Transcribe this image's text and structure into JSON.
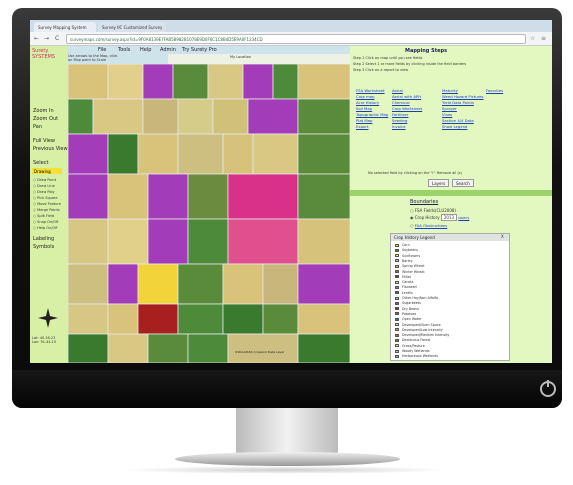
{
  "browser": {
    "tabs": [
      {
        "label": "Survey Mapping System"
      },
      {
        "label": "Survey IIC Customized Survey"
      }
    ],
    "url": "surveymaps.com/survey.aspx?id=9F0A8139E7FAB58982B1078E9D0F6C1C8B4D5E9A0F1234CD",
    "nav": {
      "back": "←",
      "forward": "→",
      "reload": "C"
    }
  },
  "leftpanel": {
    "logo": "Surety\nSYSTEMS",
    "items": [
      {
        "label": "Zoom In"
      },
      {
        "label": "Zoom Out"
      },
      {
        "label": "Pan"
      },
      {
        "label": "Full View"
      },
      {
        "label": "Previous View"
      },
      {
        "label": "Select"
      },
      {
        "label": "Drawing"
      }
    ],
    "draw_options": [
      "Draw Point",
      "Draw Line",
      "Draw Poly",
      "Pick Square",
      "Move Feature",
      "Merge Points",
      "Split Field",
      "Snap On/Off",
      "Help On/Off"
    ],
    "bottom_items": [
      {
        "label": "Labeling"
      },
      {
        "label": "Symbols"
      }
    ],
    "coords": "Lat: 40.16.23\nLon: 91.44.15"
  },
  "menubar": {
    "items": [
      "File",
      "Tools",
      "Help",
      "Admin",
      "Try Surety Pro"
    ]
  },
  "map_header": {
    "instructions": "Use arrows to the Map, click\non Map point to Scale",
    "location": "My Location"
  },
  "map": {
    "credit": "USDA-NASS Cropland Data Layer"
  },
  "rightpanel": {
    "title": "Mapping Steps",
    "steps": [
      "Step 1   Click on map until you see fields",
      "Step 2   Select 1 or more fields by clicking inside the field borders",
      "Step 3   Click on a report to view"
    ],
    "links_col1": [
      "FSA Worksheet",
      "Crop map",
      "Acre History",
      "Soil Map",
      "Topographic Map",
      "Plat Map",
      "Export"
    ],
    "links_col2": [
      "Aerial",
      "Aerial with APH",
      "Chemical",
      "Crop Worksheet",
      "Fertilizer",
      "Seeding",
      "Invoice"
    ],
    "links_col3": [
      "Maturity",
      "Weed Hazard Pictures",
      "Yield Data Points",
      "Sprayer",
      "Vines",
      "Section 4/4 Data",
      "Show Legend"
    ],
    "links_col4": [
      "Favorites"
    ],
    "select_msg": "No selected field by clicking on the \"i\".  Remove all (s)",
    "btn_layers": "Layers",
    "btn_search": "Search",
    "boundaries_title": "Boundaries",
    "boundary_opts": [
      "FSA Fields(CLU2008)",
      "Crop History",
      "FAA Obstructions"
    ],
    "year": "2013",
    "year_link": "query",
    "legend": {
      "title": "Crop History Legend",
      "close": "X",
      "items": [
        {
          "name": "Corn",
          "color": "#f2d43a"
        },
        {
          "name": "Soybeans",
          "color": "#2e8b2e"
        },
        {
          "name": "Sunflowers",
          "color": "#f6e76a"
        },
        {
          "name": "Barley",
          "color": "#e8a3c3"
        },
        {
          "name": "Spring Wheat",
          "color": "#d9b65a"
        },
        {
          "name": "Winter Wheat",
          "color": "#a06b3a"
        },
        {
          "name": "Millet",
          "color": "#8b1a4a"
        },
        {
          "name": "Canola",
          "color": "#e0e060"
        },
        {
          "name": "Flaxseed",
          "color": "#6c7bd6"
        },
        {
          "name": "Lentils",
          "color": "#1a6b8b"
        },
        {
          "name": "Other Hay/Non Alfalfa",
          "color": "#a8c98a"
        },
        {
          "name": "Sugarbeets",
          "color": "#a23cb8"
        },
        {
          "name": "Dry Beans",
          "color": "#a81f1f"
        },
        {
          "name": "Potatoes",
          "color": "#7a5d3a"
        },
        {
          "name": "Open Water",
          "color": "#3a5ad8"
        },
        {
          "name": "Developed/Open Space",
          "color": "#c9c9c9"
        },
        {
          "name": "Developed/Low Intensity",
          "color": "#d88888"
        },
        {
          "name": "Developed/Medium Intensity",
          "color": "#d84a4a"
        },
        {
          "name": "Deciduous Forest",
          "color": "#3a8b3a"
        },
        {
          "name": "Grass/Pasture",
          "color": "#d6e89a"
        },
        {
          "name": "Woody Wetlands",
          "color": "#9ac8c8"
        },
        {
          "name": "Herbaceous Wetlands",
          "color": "#6aa8c8"
        }
      ]
    }
  },
  "colors": {
    "leftpanel_bg": "#d7f0a6",
    "rightpanel_bg": "#e3f7c0",
    "link": "#1a3fbf",
    "drawing_highlight": "#f5e03a"
  }
}
